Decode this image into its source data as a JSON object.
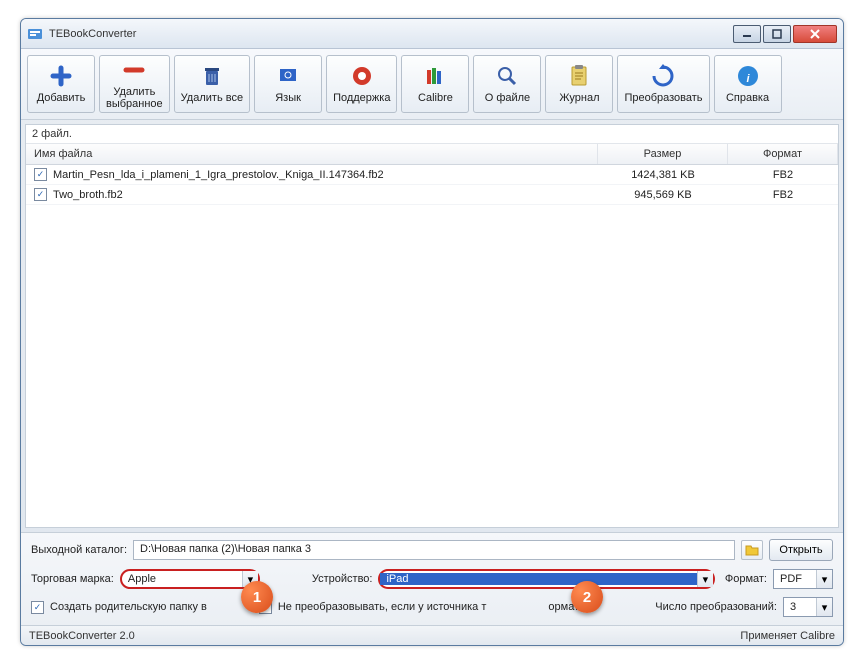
{
  "window": {
    "title": "TEBookConverter"
  },
  "toolbar": {
    "add": "Добавить",
    "removeSel": "Удалить\nвыбранное",
    "removeAll": "Удалить все",
    "lang": "Язык",
    "support": "Поддержка",
    "calibre": "Calibre",
    "about": "О файле",
    "log": "Журнал",
    "convert": "Преобразовать",
    "help": "Справка"
  },
  "list": {
    "count": "2 файл.",
    "headers": {
      "name": "Имя файла",
      "size": "Размер",
      "format": "Формат"
    },
    "rows": [
      {
        "name": "Martin_Pesn_lda_i_plameni_1_Igra_prestolov._Kniga_II.147364.fb2",
        "size": "1424,381 KB",
        "format": "FB2"
      },
      {
        "name": "Two_broth.fb2",
        "size": "945,569 KB",
        "format": "FB2"
      }
    ]
  },
  "bottom": {
    "outputLabel": "Выходной каталог:",
    "outputPath": "D:\\Новая папка (2)\\Новая папка 3",
    "open": "Открыть",
    "brandLabel": "Торговая марка:",
    "brand": "Apple",
    "deviceLabel": "Устройство:",
    "device": "iPad",
    "formatLabel": "Формат:",
    "format": "PDF",
    "chk1": "Создать родительскую папку в",
    "chk2": "Не преобразовывать, если у источника т",
    "chk2suffix": "ормат",
    "jobsLabel": "Число преобразований:",
    "jobs": "3"
  },
  "status": {
    "left": "TEBookConverter 2.0",
    "right": "Применяет Calibre"
  },
  "annotations": {
    "a1": "1",
    "a2": "2"
  }
}
